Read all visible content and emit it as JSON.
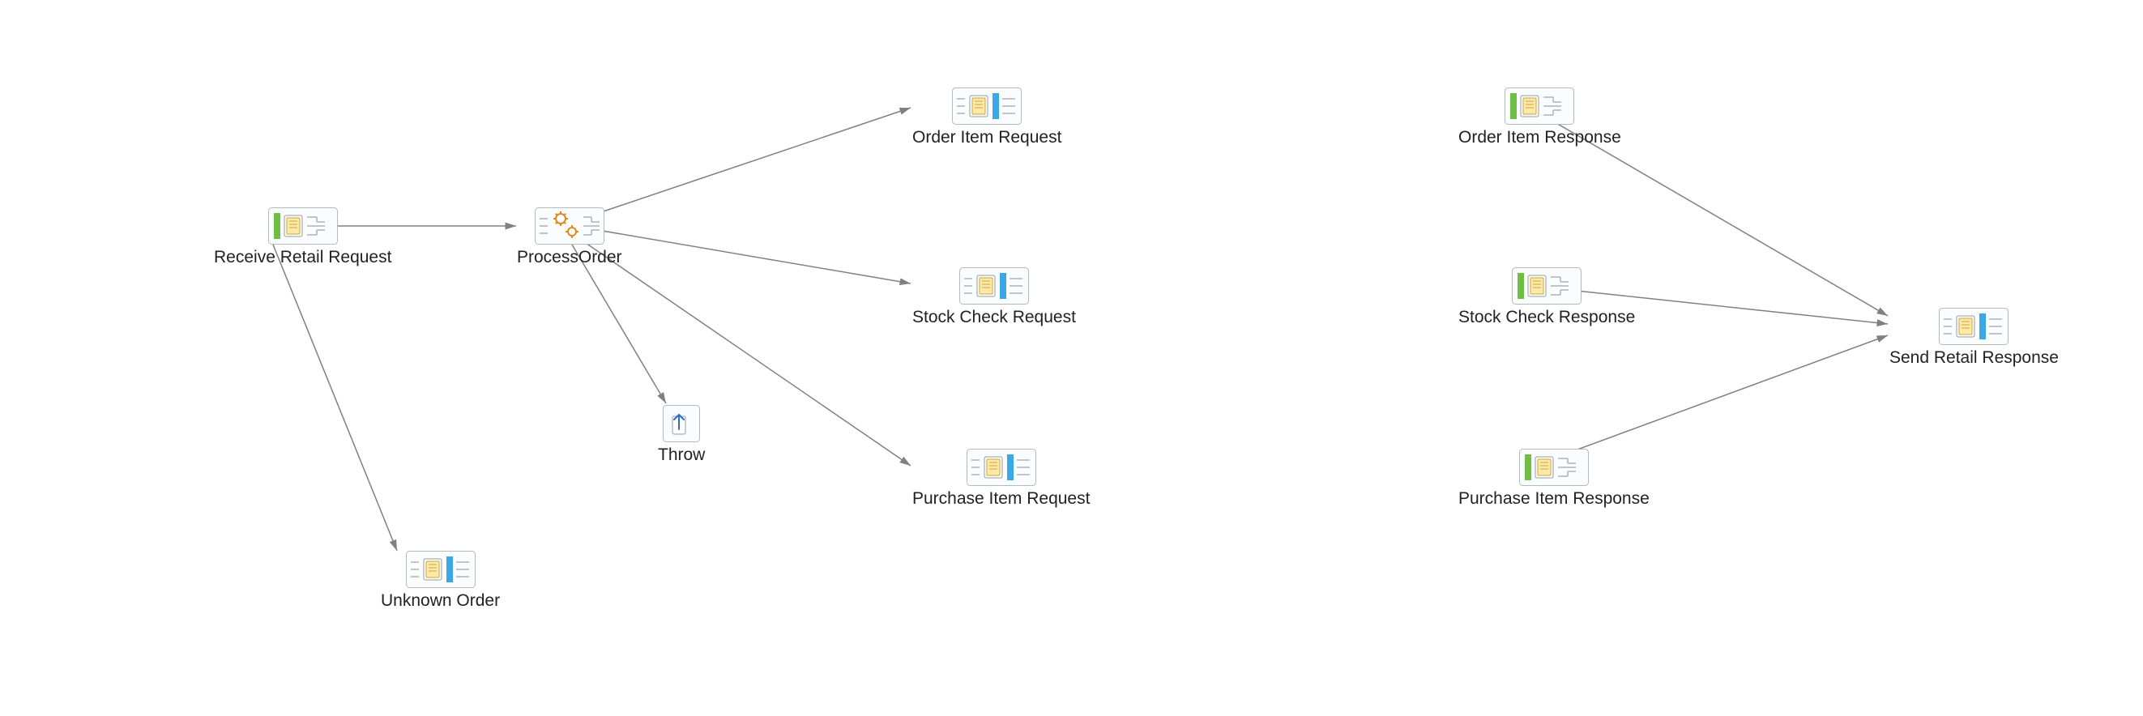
{
  "nodes": {
    "receive_retail_request": {
      "label": "Receive Retail Request",
      "type": "port-in"
    },
    "process_order": {
      "label": "ProcessOrder",
      "type": "gears"
    },
    "throw": {
      "label": "Throw",
      "type": "throw"
    },
    "unknown_order": {
      "label": "Unknown Order",
      "type": "port-out"
    },
    "order_item_request": {
      "label": "Order Item Request",
      "type": "port-out"
    },
    "stock_check_request": {
      "label": "Stock Check Request",
      "type": "port-out"
    },
    "purchase_item_request": {
      "label": "Purchase Item Request",
      "type": "port-out"
    },
    "order_item_response": {
      "label": "Order Item Response",
      "type": "port-in"
    },
    "stock_check_response": {
      "label": "Stock Check Response",
      "type": "port-in"
    },
    "purchase_item_response": {
      "label": "Purchase Item Response",
      "type": "port-in"
    },
    "send_retail_response": {
      "label": "Send Retail Response",
      "type": "port-out"
    }
  },
  "edges": [
    {
      "from": "receive_retail_request",
      "to": "process_order"
    },
    {
      "from": "receive_retail_request",
      "to": "unknown_order"
    },
    {
      "from": "process_order",
      "to": "order_item_request"
    },
    {
      "from": "process_order",
      "to": "stock_check_request"
    },
    {
      "from": "process_order",
      "to": "purchase_item_request"
    },
    {
      "from": "process_order",
      "to": "throw"
    },
    {
      "from": "order_item_response",
      "to": "send_retail_response"
    },
    {
      "from": "stock_check_response",
      "to": "send_retail_response"
    },
    {
      "from": "purchase_item_response",
      "to": "send_retail_response"
    }
  ]
}
